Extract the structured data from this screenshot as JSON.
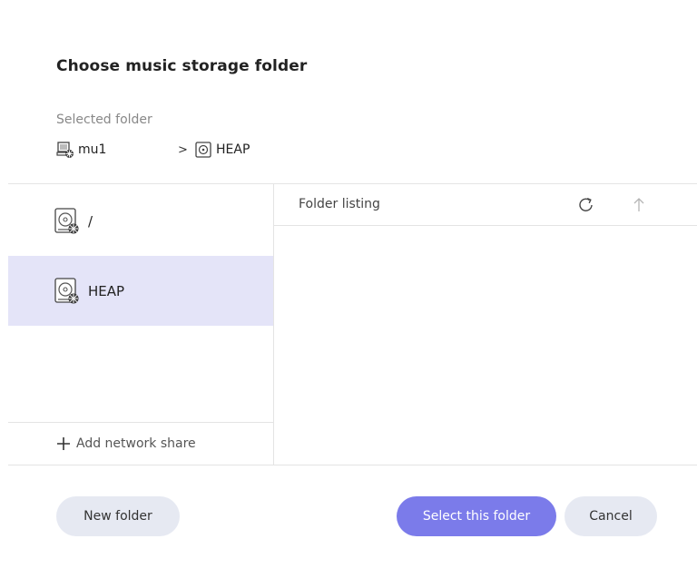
{
  "dialog": {
    "title": "Choose music storage folder",
    "selected_label": "Selected folder"
  },
  "breadcrumb": {
    "host": {
      "label": "mu1",
      "icon": "network-computer-icon"
    },
    "separator": ">",
    "drive": {
      "label": "HEAP",
      "icon": "drive-icon"
    }
  },
  "drives": [
    {
      "label": "/",
      "icon": "hard-drive-icon",
      "selected": false
    },
    {
      "label": "HEAP",
      "icon": "hard-drive-icon",
      "selected": true
    }
  ],
  "add_share": {
    "label": "Add network share",
    "icon": "plus-icon"
  },
  "listing": {
    "title": "Folder listing",
    "refresh_icon": "refresh-icon",
    "up_icon": "arrow-up-icon"
  },
  "buttons": {
    "new_folder": "New folder",
    "select": "Select this folder",
    "cancel": "Cancel"
  },
  "colors": {
    "accent": "#7b7bea",
    "selected_row": "#e4e4f8",
    "secondary_button": "#e6e9f2"
  }
}
